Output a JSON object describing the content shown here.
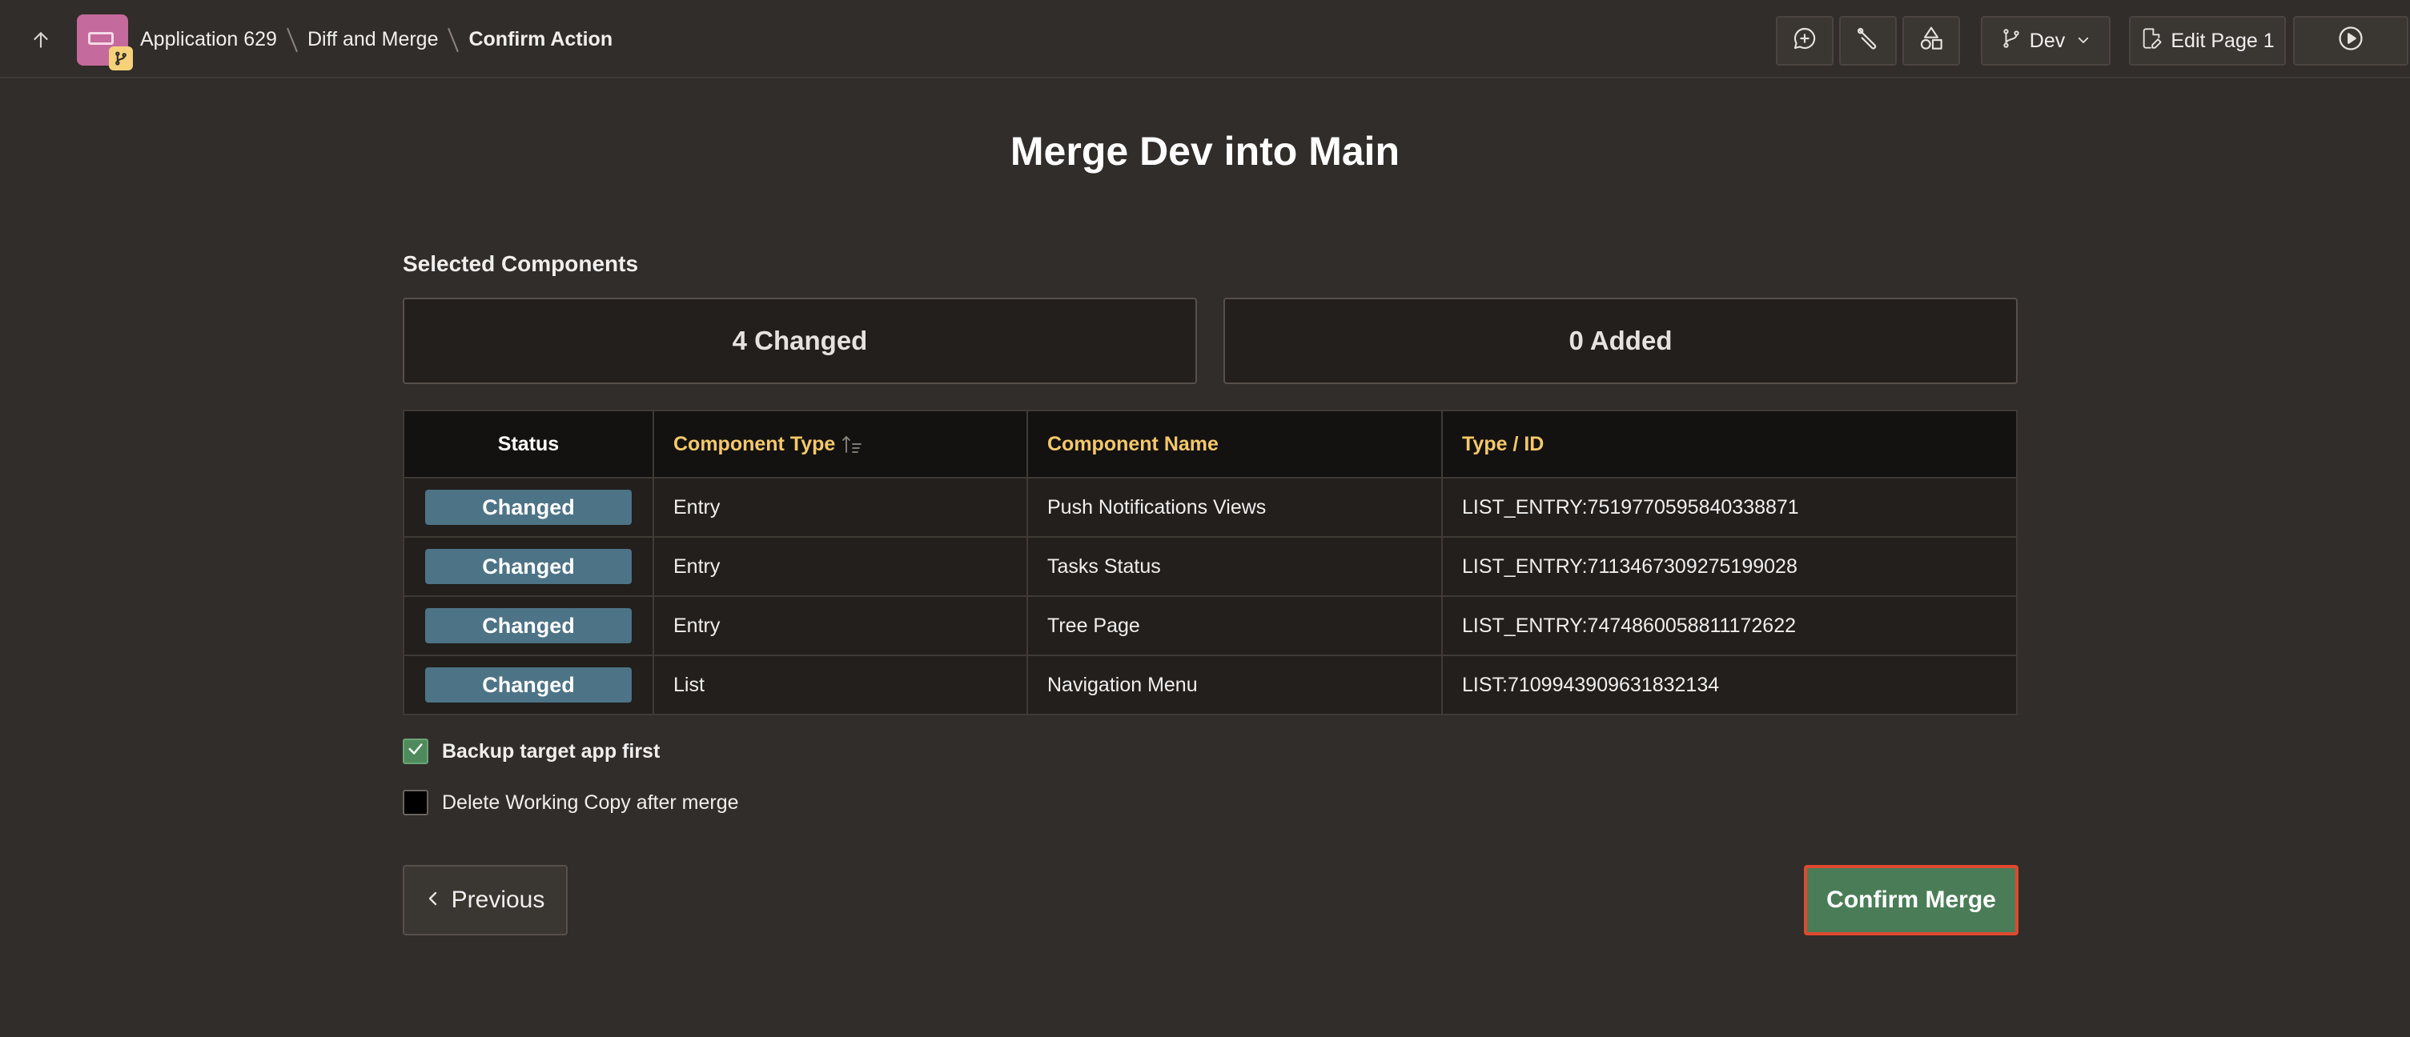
{
  "header": {
    "breadcrumb": {
      "app": "Application 629",
      "section": "Diff and Merge",
      "current": "Confirm Action"
    },
    "toolbar": {
      "branch_label": "Dev",
      "edit_page_label": "Edit Page 1"
    }
  },
  "main": {
    "title": "Merge Dev into Main",
    "section_label": "Selected Components",
    "summary": {
      "changed": "4 Changed",
      "added": "0 Added"
    },
    "table": {
      "headers": [
        "Status",
        "Component Type",
        "Component Name",
        "Type / ID"
      ],
      "rows": [
        {
          "status": "Changed",
          "type": "Entry",
          "name": "Push Notifications Views",
          "id": "LIST_ENTRY:7519770595840338871"
        },
        {
          "status": "Changed",
          "type": "Entry",
          "name": "Tasks Status",
          "id": "LIST_ENTRY:7113467309275199028"
        },
        {
          "status": "Changed",
          "type": "Entry",
          "name": "Tree Page",
          "id": "LIST_ENTRY:7474860058811172622"
        },
        {
          "status": "Changed",
          "type": "List",
          "name": "Navigation Menu",
          "id": "LIST:7109943909631832134"
        }
      ]
    },
    "options": {
      "backup_label": "Backup target app first",
      "backup_checked": true,
      "delete_label": "Delete Working Copy after merge",
      "delete_checked": false
    },
    "buttons": {
      "previous": "Previous",
      "confirm": "Confirm Merge"
    }
  },
  "colors": {
    "background": "#312d2a",
    "status_pill": "#4d7386",
    "confirm_button": "#4a7d57",
    "confirm_outline": "#e0492e",
    "sortable_header": "#f4c86a",
    "checkbox_checked": "#4f8a5d"
  },
  "icons": {
    "back": "arrow-up-icon",
    "app": "app-icon",
    "branch_badge": "git-branch-icon",
    "comment": "comment-add-icon",
    "dev_toolbar": "wrench-icon",
    "shared_components": "shapes-icon",
    "branch": "git-branch-icon",
    "edit_page": "edit-page-icon",
    "run": "play-icon",
    "sort": "sort-ascending-icon",
    "previous": "chevron-left-icon",
    "check": "check-icon"
  }
}
